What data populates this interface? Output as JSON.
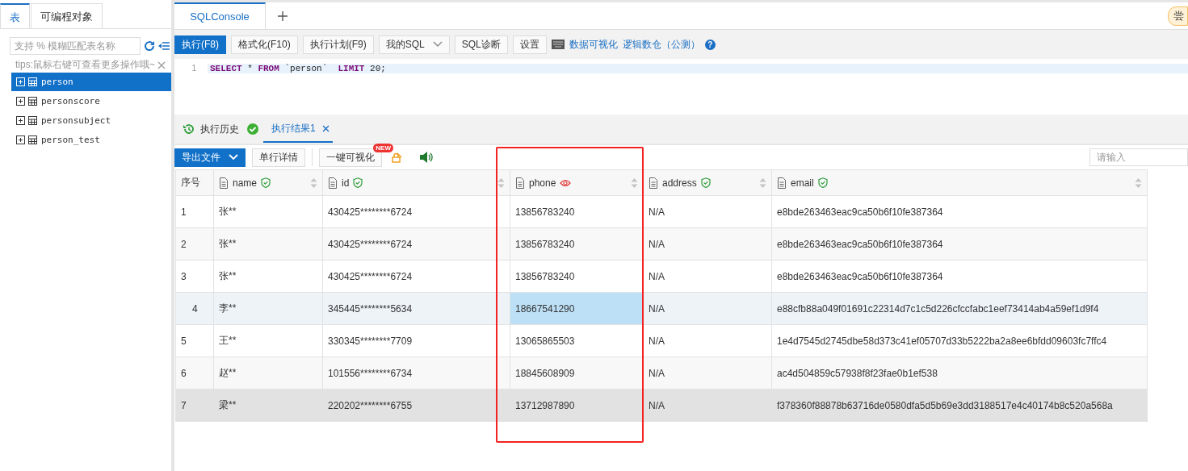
{
  "sidebar": {
    "tabs": [
      {
        "label": "表",
        "selected": true
      },
      {
        "label": "可编程对象",
        "selected": false
      }
    ],
    "search": {
      "placeholder": "支持 % 模糊匹配表名称"
    },
    "tip": "tips:鼠标右键可查看更多操作哦~",
    "tables": [
      {
        "name": "person",
        "selected": true
      },
      {
        "name": "personscore",
        "selected": false
      },
      {
        "name": "personsubject",
        "selected": false
      },
      {
        "name": "person_test",
        "selected": false
      }
    ]
  },
  "editor_tabs": [
    {
      "label": "SQLConsole",
      "selected": true
    }
  ],
  "trial_badge": "尝",
  "toolbar": {
    "buttons": [
      {
        "label": "执行(F8)",
        "kind": "primary"
      },
      {
        "label": "格式化(F10)",
        "kind": "plain"
      },
      {
        "label": "执行计划(F9)",
        "kind": "plain"
      },
      {
        "label": "我的SQL",
        "kind": "dropdown"
      },
      {
        "label": "SQL诊断",
        "kind": "plain"
      },
      {
        "label": "设置",
        "kind": "plain"
      }
    ],
    "links": [
      "数据可视化",
      "逻辑数仓（公测）"
    ],
    "help": "?"
  },
  "editor": {
    "lines": [
      {
        "number": "1",
        "code": "**SELECT** * **FROM** `person`  **LIMIT** 20;"
      }
    ]
  },
  "result_tabs": [
    {
      "label": "执行历史",
      "kind": "history",
      "selected": false
    },
    {
      "label": "执行结果1",
      "kind": "result",
      "selected": true
    }
  ],
  "result_toolbar": {
    "export": "导出文件",
    "detail": "单行详情",
    "visualize": "一键可视化",
    "new_badge": "NEW",
    "filter_placeholder": "请输入"
  },
  "table": {
    "index_header": "序号",
    "columns": [
      {
        "name": "name",
        "exposed": false,
        "highlighted": false
      },
      {
        "name": "id",
        "exposed": false,
        "highlighted": false
      },
      {
        "name": "phone",
        "exposed": true,
        "highlighted": true
      },
      {
        "name": "address",
        "exposed": false,
        "highlighted": false
      },
      {
        "name": "email",
        "exposed": false,
        "highlighted": false
      }
    ],
    "rows": [
      {
        "index": "1",
        "selected": false,
        "hovered": false,
        "cells": [
          "张**",
          "430425********6724",
          "13856783240",
          "N/A",
          "e8bde263463eac9ca50b6f10fe387364"
        ]
      },
      {
        "index": "2",
        "selected": false,
        "hovered": false,
        "cells": [
          "张**",
          "430425********6724",
          "13856783240",
          "N/A",
          "e8bde263463eac9ca50b6f10fe387364"
        ]
      },
      {
        "index": "3",
        "selected": false,
        "hovered": false,
        "cells": [
          "张**",
          "430425********6724",
          "13856783240",
          "N/A",
          "e8bde263463eac9ca50b6f10fe387364"
        ]
      },
      {
        "index": "4",
        "selected": true,
        "hovered": false,
        "cells": [
          "李**",
          "345445********5634",
          "18667541290",
          "N/A",
          "e88cfb88a049f01691c22314d7c1c5d226cfccfabc1eef73414ab4a59ef1d9f4"
        ]
      },
      {
        "index": "5",
        "selected": false,
        "hovered": false,
        "cells": [
          "王**",
          "330345********7709",
          "13065865503",
          "N/A",
          "1e4d7545d2745dbe58d373c41ef05707d33b5222ba2a8ee6bfdd09603fc7ffc4"
        ]
      },
      {
        "index": "6",
        "selected": false,
        "hovered": false,
        "cells": [
          "赵**",
          "101556********6734",
          "18845608909",
          "N/A",
          "ac4d504859c57938f8f23fae0b1ef538"
        ]
      },
      {
        "index": "7",
        "selected": false,
        "hovered": true,
        "cells": [
          "梁**",
          "220202********6755",
          "13712987890",
          "N/A",
          "f378360f88878b63716de0580dfa5d5b69e3dd3188517e4c40174b8c520a568a"
        ]
      }
    ]
  }
}
